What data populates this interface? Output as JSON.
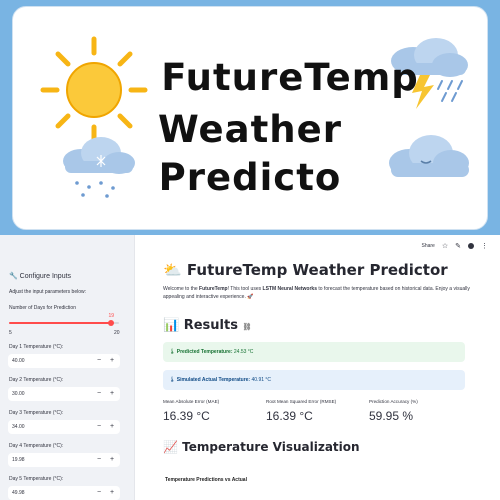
{
  "banner": {
    "line1": "FutureTemp",
    "line2": "Weather",
    "line3": "Predicto"
  },
  "sidebar": {
    "heading": "Configure Inputs",
    "subheading": "Adjust the input parameters below:",
    "slider": {
      "label": "Number of Days for Prediction",
      "value": "19",
      "min": "5",
      "max": "20",
      "fraction": 0.93
    },
    "inputs": [
      {
        "label": "Day 1 Temperature (°C):",
        "value": "40.00"
      },
      {
        "label": "Day 2 Temperature (°C):",
        "value": "30.00"
      },
      {
        "label": "Day 3 Temperature (°C):",
        "value": "34.00"
      },
      {
        "label": "Day 4 Temperature (°C):",
        "value": "19.98"
      },
      {
        "label": "Day 5 Temperature (°C):",
        "value": "49.98"
      }
    ]
  },
  "toolbar": {
    "share": "Share"
  },
  "main": {
    "title": "FutureTemp Weather Predictor",
    "intro_pre": "Welcome to the ",
    "intro_bold1": "FutureTemp",
    "intro_mid": "! This tool uses ",
    "intro_bold2": "LSTM Neural Networks",
    "intro_post": " to forecast the temperature based on historical data. Enjoy a visually appealing and interactive experience. 🚀",
    "results_heading": "Results",
    "predicted_label": "Predicted Temperature:",
    "predicted_value": "24.53 °C",
    "actual_label": "Simulated Actual Temperature:",
    "actual_value": "40.91 °C",
    "metrics": [
      {
        "label": "Mean Absolute Error (MAE)",
        "value": "16.39 °C"
      },
      {
        "label": "Root Mean Squared Error (RMSE)",
        "value": "16.39 °C"
      },
      {
        "label": "Prediction Accuracy (%)",
        "value": "59.95 %"
      }
    ],
    "viz_heading": "Temperature Visualization",
    "chart_title": "Temperature Predictions vs Actual"
  },
  "colors": {
    "banner_bg": "#79b4e3",
    "success_bg": "#e9f7ec",
    "success_text": "#177233",
    "info_bg": "#e6f0fb",
    "info_text": "#0f4a85",
    "slider_red": "#ff4b4b"
  }
}
